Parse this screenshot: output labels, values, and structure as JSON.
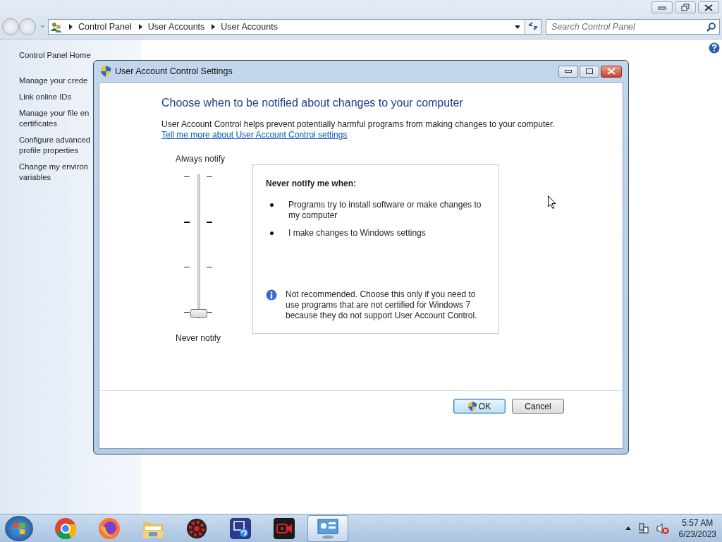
{
  "explorer": {
    "breadcrumbs": [
      "Control Panel",
      "User Accounts",
      "User Accounts"
    ],
    "search": {
      "placeholder": "Search Control Panel"
    }
  },
  "sidebar": {
    "items": [
      {
        "kind": "home",
        "text": "Control Panel Home"
      },
      {
        "kind": "link",
        "text": "Manage your crede"
      },
      {
        "kind": "link",
        "text": "Link online IDs"
      },
      {
        "kind": "link",
        "text": "Manage your file en\ncertificates"
      },
      {
        "kind": "link",
        "text": "Configure advanced\nprofile properties"
      },
      {
        "kind": "link",
        "text": "Change my environ\nvariables"
      }
    ]
  },
  "dialog": {
    "title": "User Account Control Settings",
    "heading": "Choose when to be notified about changes to your computer",
    "description": "User Account Control helps prevent potentially harmful programs from making changes to your computer.",
    "link": "Tell me more about User Account Control settings",
    "slider": {
      "top_label": "Always notify",
      "bottom_label": "Never notify",
      "level": 0
    },
    "info": {
      "title": "Never notify me when:",
      "bullets": [
        "Programs try to install software or make changes to my computer",
        "I make changes to Windows settings"
      ],
      "note": "Not recommended. Choose this only if you need to use programs that are not certified for Windows 7 because they do not support User Account Control."
    },
    "buttons": [
      {
        "label": "OK",
        "default": true
      },
      {
        "label": "Cancel",
        "default": false
      }
    ]
  },
  "taskbar": {
    "apps": [
      {
        "kind": "chrome",
        "selected": false
      },
      {
        "kind": "firefox",
        "selected": false
      },
      {
        "kind": "folder",
        "selected": false
      },
      {
        "kind": "gear",
        "selected": false
      },
      {
        "kind": "picture",
        "selected": false
      },
      {
        "kind": "camera",
        "selected": false
      },
      {
        "kind": "panel",
        "selected": true
      }
    ],
    "clock": {
      "time": "5:57 AM",
      "date": "6/23/2023"
    }
  }
}
